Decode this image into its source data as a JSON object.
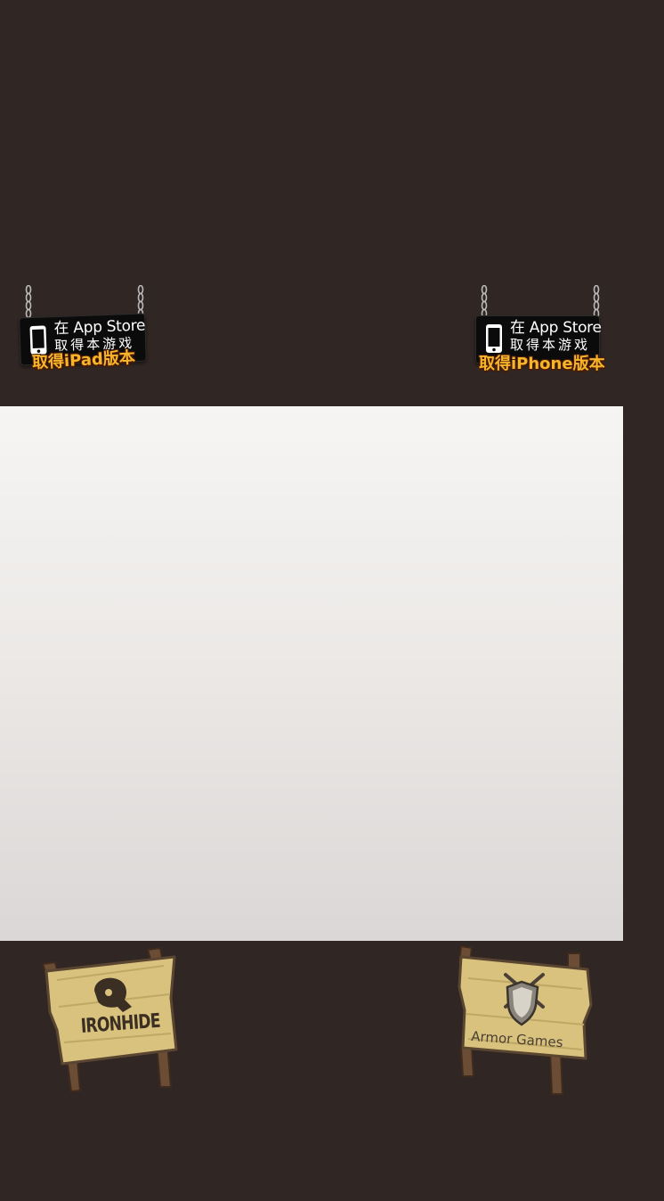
{
  "colors": {
    "page_background": "#302623",
    "game_background_top": "#f6f5f3",
    "game_background_bottom": "#dad7d6",
    "badge_plate": "#0b0b0b",
    "badge_caption": "#f7b52a",
    "wood_sign": "#d8c27e",
    "wood_post": "#6b4c34"
  },
  "app_store_badges": [
    {
      "icon": "phone-icon",
      "line1": "在 App Store",
      "line2": "取得本游戏",
      "caption": "取得iPad版本"
    },
    {
      "icon": "phone-icon",
      "line1": "在 App Store",
      "line2": "取得本游戏",
      "caption": "取得iPhone版本"
    }
  ],
  "game_area": {
    "state": "blank"
  },
  "signposts": [
    {
      "icon": "ironhide-helmet-logo",
      "label": "IRONHIDE"
    },
    {
      "icon": "armor-games-shield-logo",
      "label": "Armor Games"
    }
  ]
}
